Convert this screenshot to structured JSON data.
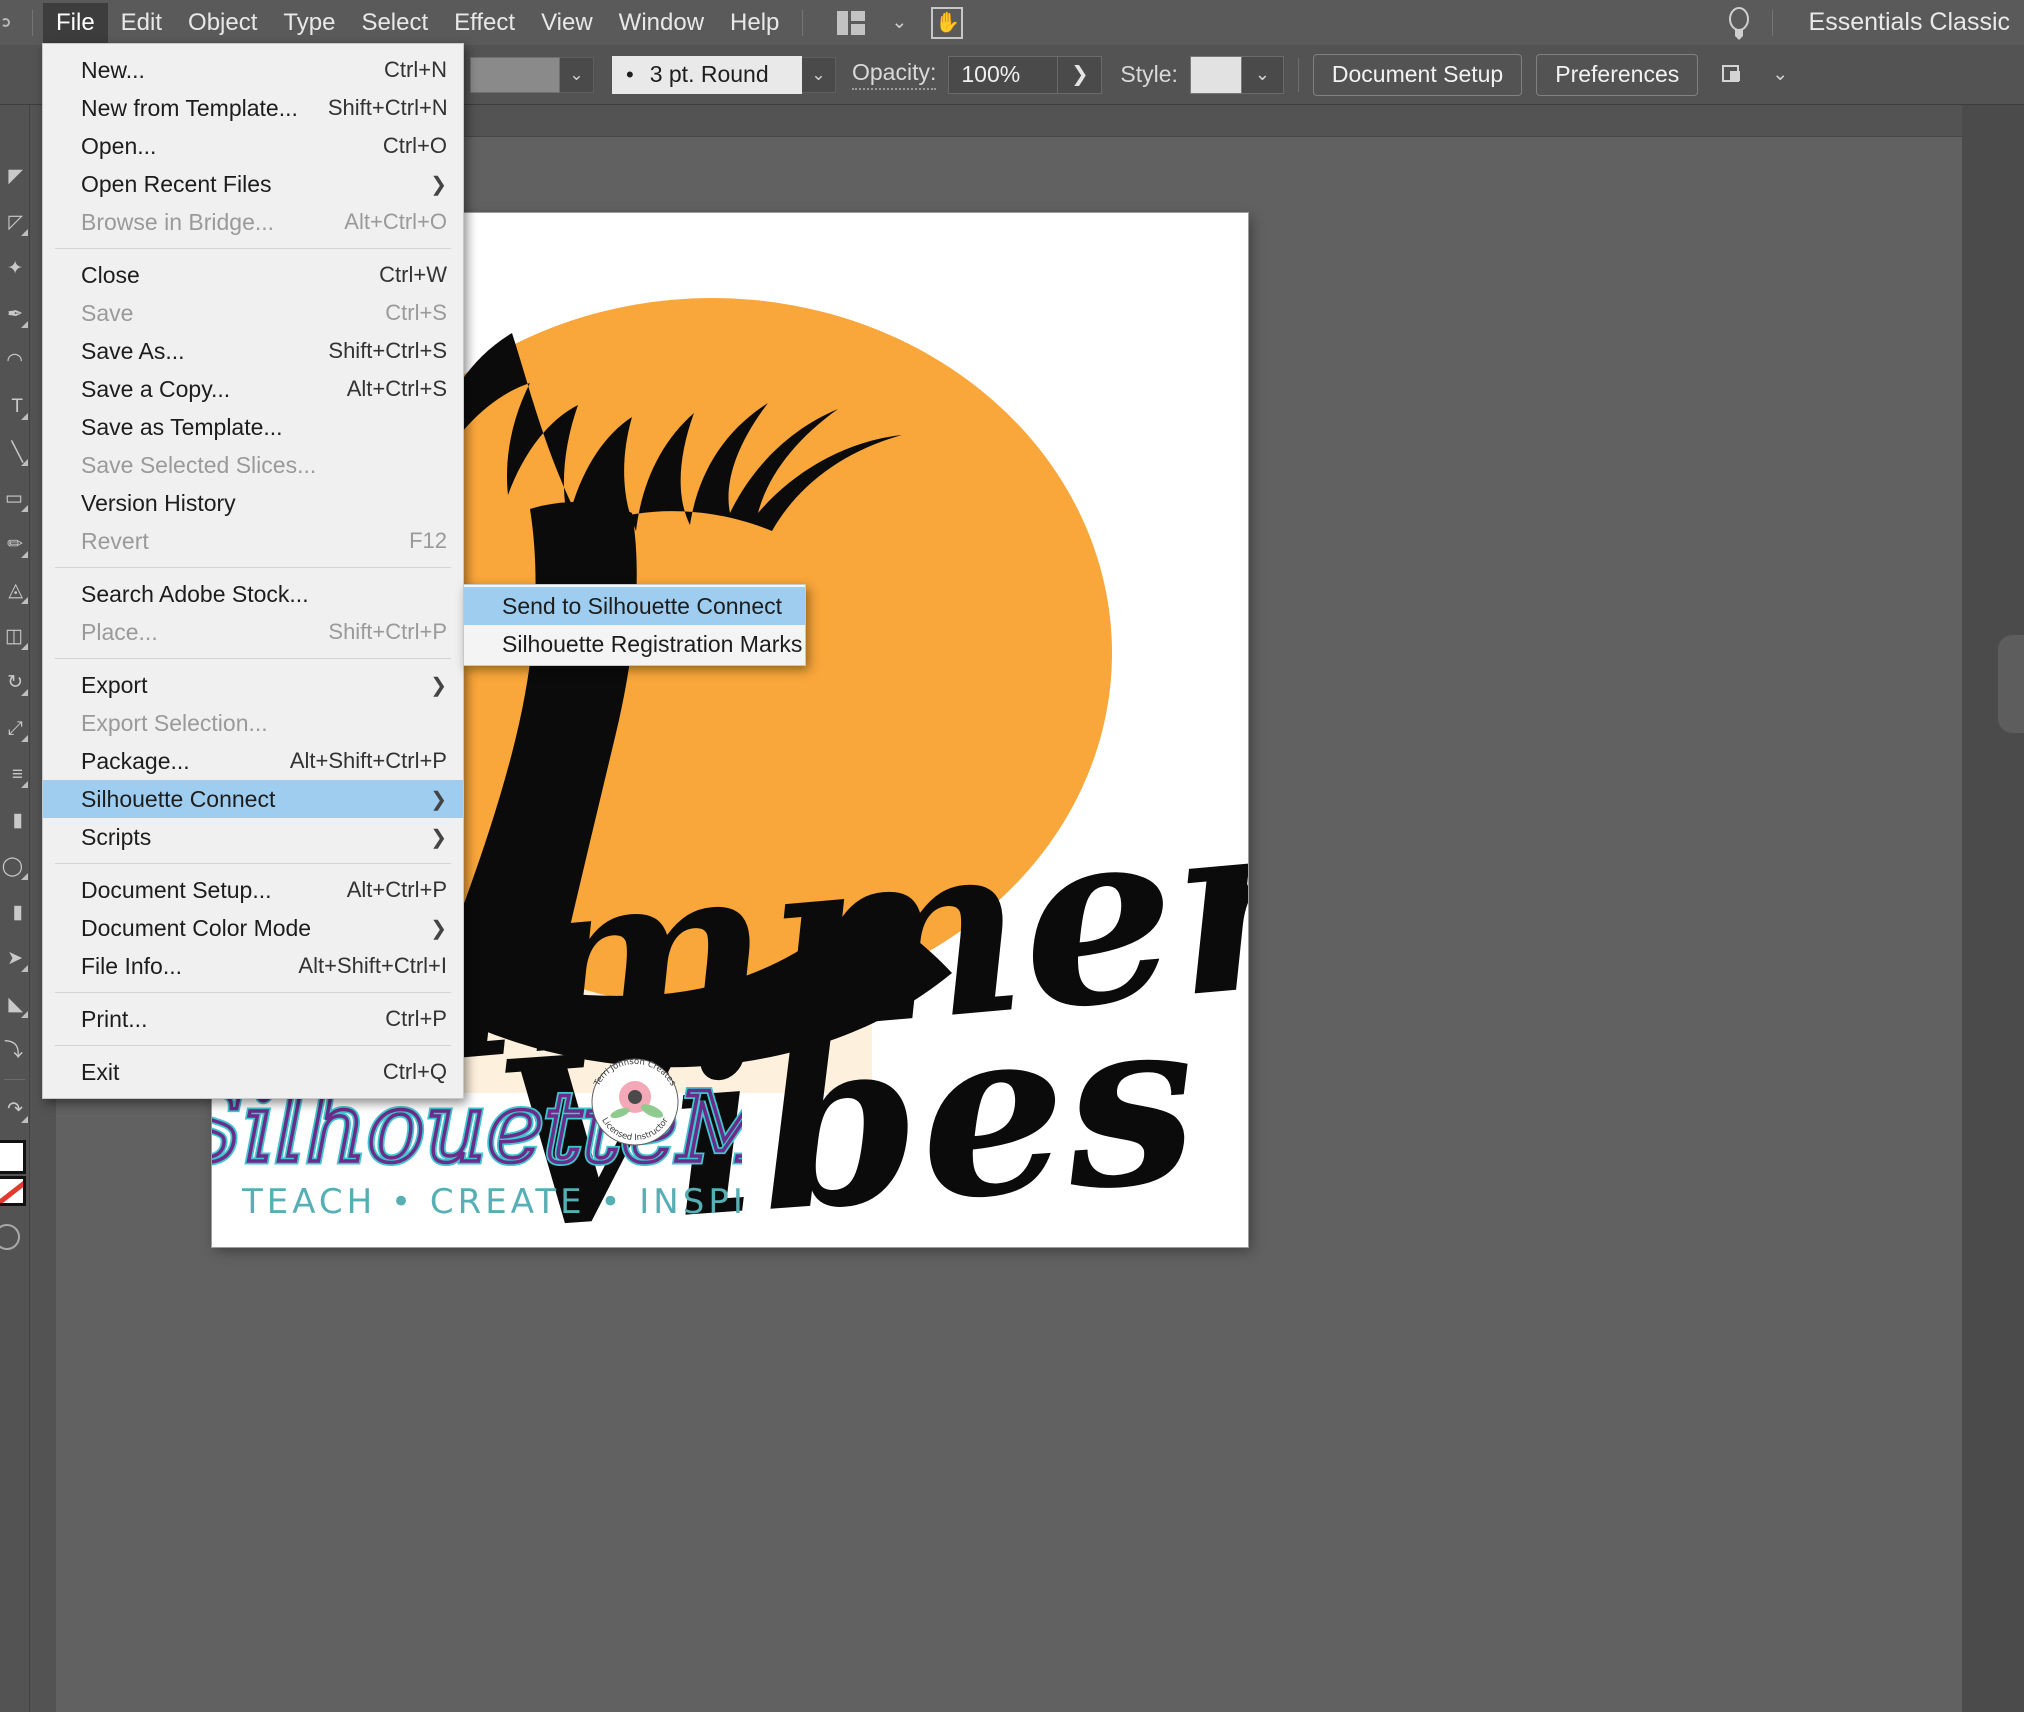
{
  "app": {
    "workspace_name": "Essentials Classic"
  },
  "menubar": {
    "items": [
      {
        "label": "File",
        "active": true
      },
      {
        "label": "Edit",
        "active": false
      },
      {
        "label": "Object",
        "active": false
      },
      {
        "label": "Type",
        "active": false
      },
      {
        "label": "Select",
        "active": false
      },
      {
        "label": "Effect",
        "active": false
      },
      {
        "label": "View",
        "active": false
      },
      {
        "label": "Window",
        "active": false
      },
      {
        "label": "Help",
        "active": false
      }
    ],
    "workspace_switcher_icon": "workspace-layout-icon",
    "workspace_chevron": "⌄",
    "hand_tool_icon": "hand-tool-icon",
    "bulb_icon": "lightbulb-icon"
  },
  "controlbar": {
    "stroke_profile": "3 pt. Round",
    "stroke_bullet": "•",
    "opacity_label": "Opacity:",
    "opacity_value": "100%",
    "opacity_arrow": "❯",
    "style_label": "Style:",
    "document_setup_label": "Document Setup",
    "preferences_label": "Preferences",
    "chevron": "⌄",
    "arrange_icon": "arrange-documents-icon"
  },
  "tools": {
    "items": [
      {
        "name": "selection-tool",
        "glyph": "◤"
      },
      {
        "name": "direct-selection-tool",
        "glyph": "◸"
      },
      {
        "name": "magic-wand-tool",
        "glyph": "✦"
      },
      {
        "name": "pen-tool",
        "glyph": "✒"
      },
      {
        "name": "curvature-tool",
        "glyph": "◠"
      },
      {
        "name": "type-tool",
        "glyph": "T"
      },
      {
        "name": "line-segment-tool",
        "glyph": "╲"
      },
      {
        "name": "rectangle-tool",
        "glyph": "▭"
      },
      {
        "name": "paintbrush-tool",
        "glyph": "✏"
      },
      {
        "name": "shaper-tool",
        "glyph": "◬"
      },
      {
        "name": "eraser-tool",
        "glyph": "◫"
      },
      {
        "name": "rotate-tool",
        "glyph": "↻"
      },
      {
        "name": "scale-tool",
        "glyph": "⤢"
      },
      {
        "name": "width-tool",
        "glyph": "≡"
      },
      {
        "name": "free-transform-tool",
        "glyph": "▮"
      },
      {
        "name": "shape-builder-tool",
        "glyph": "◯"
      },
      {
        "name": "gradient-tool",
        "glyph": "▮"
      },
      {
        "name": "eyedropper-tool",
        "glyph": "➤"
      },
      {
        "name": "blend-tool",
        "glyph": "◣"
      },
      {
        "name": "artboard-tool",
        "glyph": "⤵"
      }
    ]
  },
  "file_menu": {
    "groups": [
      [
        {
          "label": "New...",
          "accel": "Ctrl+N",
          "disabled": false,
          "submenu": false,
          "selected": false
        },
        {
          "label": "New from Template...",
          "accel": "Shift+Ctrl+N",
          "disabled": false,
          "submenu": false,
          "selected": false
        },
        {
          "label": "Open...",
          "accel": "Ctrl+O",
          "disabled": false,
          "submenu": false,
          "selected": false
        },
        {
          "label": "Open Recent Files",
          "accel": "",
          "disabled": false,
          "submenu": true,
          "selected": false
        },
        {
          "label": "Browse in Bridge...",
          "accel": "Alt+Ctrl+O",
          "disabled": true,
          "submenu": false,
          "selected": false
        }
      ],
      [
        {
          "label": "Close",
          "accel": "Ctrl+W",
          "disabled": false,
          "submenu": false,
          "selected": false
        },
        {
          "label": "Save",
          "accel": "Ctrl+S",
          "disabled": true,
          "submenu": false,
          "selected": false
        },
        {
          "label": "Save As...",
          "accel": "Shift+Ctrl+S",
          "disabled": false,
          "submenu": false,
          "selected": false
        },
        {
          "label": "Save a Copy...",
          "accel": "Alt+Ctrl+S",
          "disabled": false,
          "submenu": false,
          "selected": false
        },
        {
          "label": "Save as Template...",
          "accel": "",
          "disabled": false,
          "submenu": false,
          "selected": false
        },
        {
          "label": "Save Selected Slices...",
          "accel": "",
          "disabled": true,
          "submenu": false,
          "selected": false
        },
        {
          "label": "Version History",
          "accel": "",
          "disabled": false,
          "submenu": false,
          "selected": false
        },
        {
          "label": "Revert",
          "accel": "F12",
          "disabled": true,
          "submenu": false,
          "selected": false
        }
      ],
      [
        {
          "label": "Search Adobe Stock...",
          "accel": "",
          "disabled": false,
          "submenu": false,
          "selected": false
        },
        {
          "label": "Place...",
          "accel": "Shift+Ctrl+P",
          "disabled": true,
          "submenu": false,
          "selected": false
        }
      ],
      [
        {
          "label": "Export",
          "accel": "",
          "disabled": false,
          "submenu": true,
          "selected": false
        },
        {
          "label": "Export Selection...",
          "accel": "",
          "disabled": true,
          "submenu": false,
          "selected": false
        },
        {
          "label": "Package...",
          "accel": "Alt+Shift+Ctrl+P",
          "disabled": false,
          "submenu": false,
          "selected": false
        },
        {
          "label": "Silhouette Connect",
          "accel": "",
          "disabled": false,
          "submenu": true,
          "selected": true
        },
        {
          "label": "Scripts",
          "accel": "",
          "disabled": false,
          "submenu": true,
          "selected": false
        }
      ],
      [
        {
          "label": "Document Setup...",
          "accel": "Alt+Ctrl+P",
          "disabled": false,
          "submenu": false,
          "selected": false
        },
        {
          "label": "Document Color Mode",
          "accel": "",
          "disabled": false,
          "submenu": true,
          "selected": false
        },
        {
          "label": "File Info...",
          "accel": "Alt+Shift+Ctrl+I",
          "disabled": false,
          "submenu": false,
          "selected": false
        }
      ],
      [
        {
          "label": "Print...",
          "accel": "Ctrl+P",
          "disabled": false,
          "submenu": false,
          "selected": false
        }
      ],
      [
        {
          "label": "Exit",
          "accel": "Ctrl+Q",
          "disabled": false,
          "submenu": false,
          "selected": false
        }
      ]
    ]
  },
  "silhouette_submenu": {
    "items": [
      {
        "label": "Send to Silhouette Connect",
        "selected": true
      },
      {
        "label": "Silhouette Registration Marks",
        "selected": false
      }
    ]
  },
  "artwork": {
    "headline_top": "Summer",
    "headline_bottom": "Vibes",
    "logo_wordmark": "SilhouetteMade",
    "logo_tagline": "TEACH • CREATE • INSPIRE",
    "badge_top_text": "Terri Johnson Creates",
    "badge_bottom_text": "Licensed Instructor",
    "colors": {
      "sun": "#F9A63A",
      "sand": "#FDF0DC",
      "palm": "#0B0B0B",
      "logo_teal": "#3FC6CF",
      "logo_purple": "#6B2C8A",
      "tagline_teal": "#56AFB4",
      "badge_flower": "#F4A9B8"
    }
  }
}
